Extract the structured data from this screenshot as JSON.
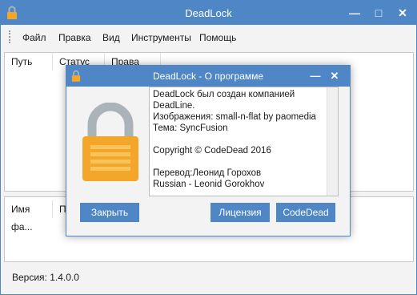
{
  "window": {
    "title": "DeadLock",
    "controls": {
      "minimize": "—",
      "maximize": "□",
      "close": "✕"
    }
  },
  "menu": [
    "Файл",
    "Правка",
    "Вид",
    "Инструменты",
    "Помощь"
  ],
  "top_table": {
    "columns": [
      "Путь",
      "Статус",
      "Права"
    ]
  },
  "bottom_table": {
    "columns": [
      "Имя фа...",
      "П"
    ]
  },
  "status_bar": {
    "version": "Версия: 1.4.0.0"
  },
  "dialog": {
    "title": "DeadLock - О программе",
    "controls": {
      "minimize": "—",
      "close": "✕"
    },
    "lines": [
      "DeadLock был создан компанией",
      "DeadLine.",
      "Изображения: small-n-flat by paomedia",
      "Тема: SyncFusion",
      "",
      "Copyright © CodeDead 2016",
      "",
      "Перевод:Леонид Горохов",
      "Russian - Leonid Gorokhov"
    ],
    "buttons": {
      "close": "Закрыть",
      "license": "Лицензия",
      "codedead": "CodeDead"
    }
  },
  "colors": {
    "accent": "#4f86c6",
    "lock_body": "#f4a62a",
    "lock_shackle": "#a9b3b8"
  }
}
